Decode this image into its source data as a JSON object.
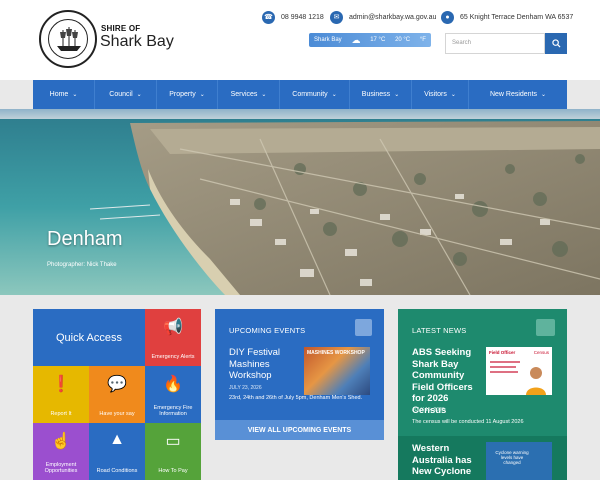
{
  "header": {
    "logo_small": "SHIRE OF",
    "logo_main": "Shark Bay",
    "contact": {
      "phone": "08 9948 1218",
      "email": "admin@sharkbay.wa.gov.au",
      "address": "65 Knight Terrace Denham WA 6537"
    },
    "weather": {
      "location": "Shark Bay",
      "temp_min": "17 °C",
      "temp_max": "20 °C",
      "unit": "°F"
    },
    "search": {
      "placeholder": "Search"
    }
  },
  "nav": {
    "items": [
      {
        "label": "Home"
      },
      {
        "label": "Council"
      },
      {
        "label": "Property"
      },
      {
        "label": "Services"
      },
      {
        "label": "Community"
      },
      {
        "label": "Business"
      },
      {
        "label": "Visitors"
      },
      {
        "label": "New Residents"
      }
    ]
  },
  "hero": {
    "title": "Denham",
    "credit": "Photographer: Nick Thake"
  },
  "quick_access": {
    "title": "Quick Access",
    "tiles": [
      {
        "label": "Emergency Alerts",
        "color": "#e0403f",
        "icon": "megaphone-icon"
      },
      {
        "label": "Report It",
        "color": "#e6b800",
        "icon": "alert-icon"
      },
      {
        "label": "Have your say",
        "color": "#f08a1c",
        "icon": "chat-icon"
      },
      {
        "label": "Emergency Fire Information",
        "color": "#2a6cc2",
        "icon": "fire-icon"
      },
      {
        "label": "Employment Opportunities",
        "color": "#9b4fcf",
        "icon": "hand-icon"
      },
      {
        "label": "Road Conditions",
        "color": "#2a6cc2",
        "icon": "road-icon"
      },
      {
        "label": "How To Pay",
        "color": "#55a33a",
        "icon": "card-icon"
      }
    ]
  },
  "events": {
    "header": "UPCOMING EVENTS",
    "item": {
      "title": "DIY Festival Mashines Workshop",
      "date": "JULY 23, 2026",
      "desc": "23rd, 24th and 26th of July 5pm, Denham Men's Shed.",
      "image_label": "MASHINES WORKSHOP"
    },
    "button": "VIEW ALL UPCOMING EVENTS"
  },
  "news": {
    "header": "LATEST NEWS",
    "item": {
      "title": "ABS Seeking Shark Bay Community Field Officers for 2026 Census",
      "date": "JULY 15, 2026",
      "desc": "The census will be conducted 11 August 2026",
      "image_label": "Field Officer",
      "image_sub": "Census"
    },
    "item2": {
      "title": "Western Australia has New Cyclone",
      "image_label": "Cyclone warning levels have changed"
    }
  },
  "colors": {
    "brand_blue": "#2a6cc2",
    "news_green": "#1e8a6e"
  }
}
